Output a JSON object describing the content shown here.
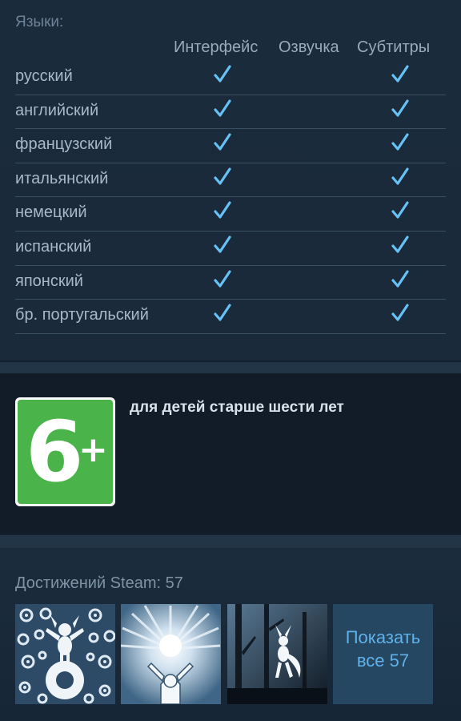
{
  "languages": {
    "title": "Языки:",
    "columns": [
      "Интерфейс",
      "Озвучка",
      "Субтитры"
    ],
    "rows": [
      {
        "name": "русский",
        "interface": true,
        "audio": false,
        "subtitles": true
      },
      {
        "name": "английский",
        "interface": true,
        "audio": false,
        "subtitles": true
      },
      {
        "name": "французский",
        "interface": true,
        "audio": false,
        "subtitles": true
      },
      {
        "name": "итальянский",
        "interface": true,
        "audio": false,
        "subtitles": true
      },
      {
        "name": "немецкий",
        "interface": true,
        "audio": false,
        "subtitles": true
      },
      {
        "name": "испанский",
        "interface": true,
        "audio": false,
        "subtitles": true
      },
      {
        "name": "японский",
        "interface": true,
        "audio": false,
        "subtitles": true
      },
      {
        "name": "бр. португальский",
        "interface": true,
        "audio": false,
        "subtitles": true
      }
    ],
    "check_color": "#67c1f5"
  },
  "rating": {
    "value": "6",
    "plus": "+",
    "description": "для детей старше шести лет",
    "badge_color": "#4ab34a"
  },
  "achievements": {
    "title": "Достижений Steam: 57",
    "show_all_line1": "Показать",
    "show_all_line2": "все 57",
    "icons": [
      "achievement-spirit-circles-icon",
      "achievement-light-burst-icon",
      "achievement-forest-creature-icon"
    ]
  }
}
